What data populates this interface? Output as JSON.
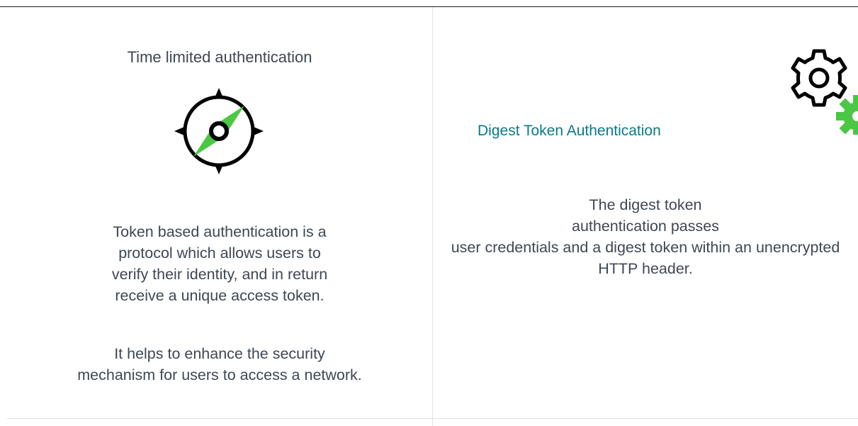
{
  "left_panel": {
    "title": "Time limited authentication",
    "icon": "compass-icon",
    "paragraph_1": "Token based authentication is a protocol which allows users to verify their identity, and in return receive a unique access token.",
    "paragraph_2": "It helps to enhance the security mechanism for users to access a network."
  },
  "right_panel": {
    "icon": "gear-icon",
    "title": "Digest Token Authentication",
    "paragraph": "The digest token authentication passes user credentials and a digest token within an unencrypted HTTP header."
  },
  "colors": {
    "body_text": "#3e4753",
    "title_accent": "#0a7a86",
    "icon_green": "#4cc745",
    "icon_black": "#000000",
    "divider": "#e3e3e3"
  }
}
